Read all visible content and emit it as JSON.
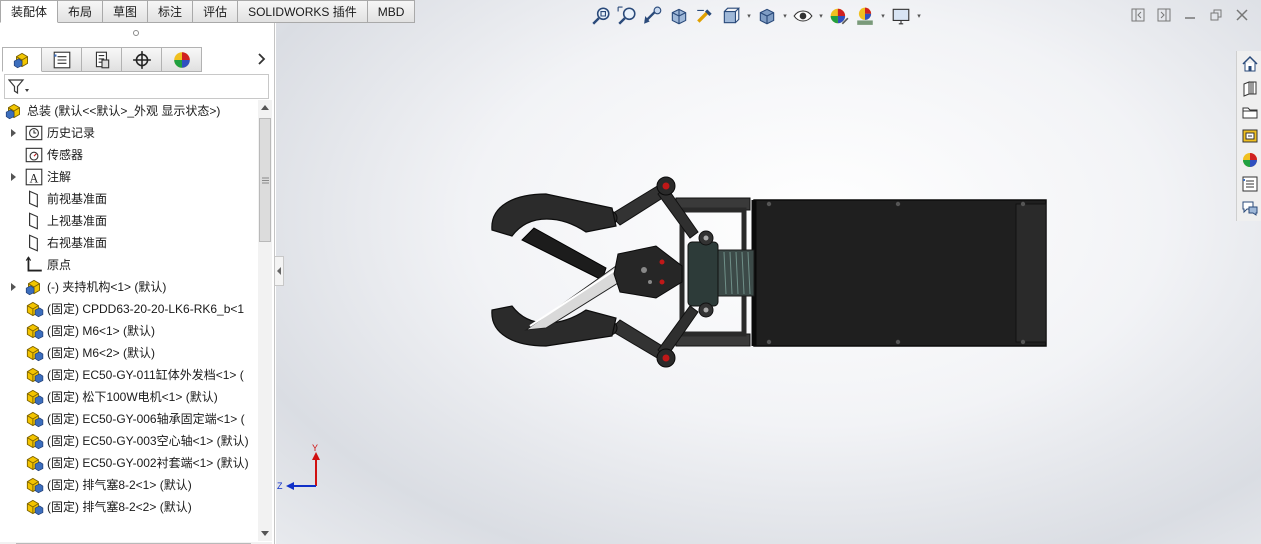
{
  "command_tabs": [
    "装配体",
    "布局",
    "草图",
    "标注",
    "评估",
    "SOLIDWORKS 插件",
    "MBD"
  ],
  "active_tab": "装配体",
  "panel_tabs": [
    {
      "name": "featuremanager-tab",
      "icon": "assembly-icon"
    },
    {
      "name": "propertymanager-tab",
      "icon": "property-list-icon"
    },
    {
      "name": "configuration-tab",
      "icon": "configuration-icon"
    },
    {
      "name": "dimxpert-tab",
      "icon": "crosshair-icon"
    },
    {
      "name": "display-manager-tab",
      "icon": "color-ball-icon"
    }
  ],
  "filter": {
    "icon": "filter-icon"
  },
  "tree": {
    "root": "总装  (默认<<默认>_外观 显示状态>)",
    "items": [
      {
        "label": "历史记录",
        "icon": "history-icon",
        "expandable": true
      },
      {
        "label": "传感器",
        "icon": "sensor-icon",
        "expandable": false
      },
      {
        "label": "注解",
        "icon": "annotation-icon",
        "expandable": true
      },
      {
        "label": "前视基准面",
        "icon": "plane-icon",
        "expandable": false
      },
      {
        "label": "上视基准面",
        "icon": "plane-icon",
        "expandable": false
      },
      {
        "label": "右视基准面",
        "icon": "plane-icon",
        "expandable": false
      },
      {
        "label": "原点",
        "icon": "origin-icon",
        "expandable": false
      },
      {
        "label": "(-) 夹持机构<1> (默认)",
        "icon": "subassembly-icon",
        "expandable": true
      },
      {
        "label": "(固定) CPDD63-20-20-LK6-RK6_b<1",
        "icon": "part-icon",
        "expandable": false
      },
      {
        "label": "(固定) M6<1> (默认)",
        "icon": "part-icon",
        "expandable": false
      },
      {
        "label": "(固定) M6<2> (默认)",
        "icon": "part-icon",
        "expandable": false
      },
      {
        "label": "(固定) EC50-GY-011缸体外发档<1> (",
        "icon": "part-icon",
        "expandable": false
      },
      {
        "label": "(固定) 松下100W电机<1> (默认)",
        "icon": "part-icon",
        "expandable": false
      },
      {
        "label": "(固定) EC50-GY-006轴承固定端<1> (",
        "icon": "part-icon",
        "expandable": false
      },
      {
        "label": "(固定) EC50-GY-003空心轴<1> (默认)",
        "icon": "part-icon",
        "expandable": false
      },
      {
        "label": "(固定) EC50-GY-002衬套端<1> (默认)",
        "icon": "part-icon",
        "expandable": false
      },
      {
        "label": "(固定) 排气塞8-2<1> (默认)",
        "icon": "part-icon",
        "expandable": false
      },
      {
        "label": "(固定) 排气塞8-2<2> (默认)",
        "icon": "part-icon",
        "expandable": false
      }
    ]
  },
  "heads_up_toolbar": [
    {
      "name": "zoom-to-fit-button",
      "icon": "zoom-fit-icon"
    },
    {
      "name": "zoom-to-area-button",
      "icon": "zoom-area-icon"
    },
    {
      "name": "previous-view-button",
      "icon": "previous-view-icon"
    },
    {
      "name": "section-view-button",
      "icon": "section-view-icon"
    },
    {
      "name": "dynamic-annotation-button",
      "icon": "annotation-view-icon"
    },
    {
      "name": "view-orientation-button",
      "icon": "view-orientation-icon",
      "dropdown": true
    },
    {
      "name": "display-style-button",
      "icon": "display-style-icon",
      "dropdown": true
    },
    {
      "name": "hide-show-button",
      "icon": "eye-icon",
      "dropdown": true
    },
    {
      "name": "edit-appearance-button",
      "icon": "appearance-icon"
    },
    {
      "name": "apply-scene-button",
      "icon": "scene-icon",
      "dropdown": true
    },
    {
      "name": "view-settings-button",
      "icon": "monitor-icon",
      "dropdown": true
    }
  ],
  "task_pane": [
    {
      "name": "solidworks-resources",
      "icon": "home-icon"
    },
    {
      "name": "design-library",
      "icon": "library-icon"
    },
    {
      "name": "file-explorer",
      "icon": "folder-icon"
    },
    {
      "name": "view-palette",
      "icon": "palette-icon"
    },
    {
      "name": "appearances-scenes",
      "icon": "color-ball-icon"
    },
    {
      "name": "custom-properties",
      "icon": "property-list-icon"
    },
    {
      "name": "solidworks-forum",
      "icon": "forum-icon"
    }
  ],
  "triad": {
    "y_label": "Y",
    "z_label": "Z"
  },
  "colors": {
    "accent": "#3c6ebd",
    "model_dark": "#2e2e2e",
    "model_body": "#1f1f1f",
    "pin_red": "#c01818",
    "triad_red": "#d01010",
    "triad_blue": "#1030c8"
  }
}
